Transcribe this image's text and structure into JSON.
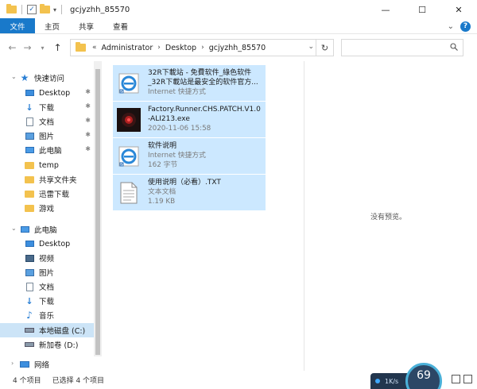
{
  "window": {
    "title": "gcjyzhh_85570",
    "minimize": "—",
    "maximize": "☐",
    "close": "✕"
  },
  "ribbon": {
    "tabs": [
      "文件",
      "主页",
      "共享",
      "查看"
    ]
  },
  "address": {
    "crumbs": [
      "Administrator",
      "Desktop",
      "gcjyzhh_85570"
    ],
    "prefix": "«"
  },
  "sidebar": {
    "items": [
      {
        "label": "快速访问",
        "icon": "star-icon"
      },
      {
        "label": "Desktop",
        "icon": "desktop-icon",
        "pinned": true
      },
      {
        "label": "下载",
        "icon": "download-icon",
        "pinned": true
      },
      {
        "label": "文档",
        "icon": "document-icon",
        "pinned": true
      },
      {
        "label": "图片",
        "icon": "picture-icon",
        "pinned": true
      },
      {
        "label": "此电脑",
        "icon": "computer-icon",
        "pinned": true
      },
      {
        "label": "temp",
        "icon": "folder-icon"
      },
      {
        "label": "共享文件夹",
        "icon": "folder-icon"
      },
      {
        "label": "迅雷下载",
        "icon": "folder-icon"
      },
      {
        "label": "游戏",
        "icon": "folder-icon"
      },
      {
        "label": "此电脑",
        "icon": "computer-icon"
      },
      {
        "label": "Desktop",
        "icon": "desktop-icon"
      },
      {
        "label": "视频",
        "icon": "video-icon"
      },
      {
        "label": "图片",
        "icon": "picture-icon"
      },
      {
        "label": "文档",
        "icon": "document-icon"
      },
      {
        "label": "下载",
        "icon": "download-icon"
      },
      {
        "label": "音乐",
        "icon": "music-icon"
      },
      {
        "label": "本地磁盘 (C:)",
        "icon": "drive-icon",
        "selected": true
      },
      {
        "label": "新加卷 (D:)",
        "icon": "drive-icon"
      },
      {
        "label": "网络",
        "icon": "network-icon"
      }
    ]
  },
  "files": [
    {
      "name1": "32R下載站 - 免費软件_綠色软件",
      "name2": "_32R下載站是最安全的软件官方...",
      "sub1": "Internet 快捷方式",
      "sub2": "",
      "icon": "ie-icon"
    },
    {
      "name1": "Factory.Runner.CHS.PATCH.V1.0",
      "name2": "-ALI213.exe",
      "sub1": "2020-11-06 15:58",
      "sub2": "",
      "icon": "exe-icon"
    },
    {
      "name1": "软件说明",
      "name2": "",
      "sub1": "Internet 快捷方式",
      "sub2": "162 字节",
      "icon": "ie-icon"
    },
    {
      "name1": "使用说明（必看）.TXT",
      "name2": "",
      "sub1": "文本文档",
      "sub2": "1.19 KB",
      "icon": "txt-icon"
    }
  ],
  "preview": {
    "empty_text": "没有预览。"
  },
  "status": {
    "count": "4 个项目",
    "selected": "已选择 4 个项目"
  },
  "widget": {
    "net_speed": "1K/s",
    "gauge_value": "69"
  },
  "colors": {
    "accent": "#1979ca",
    "selection": "#cce8ff"
  }
}
